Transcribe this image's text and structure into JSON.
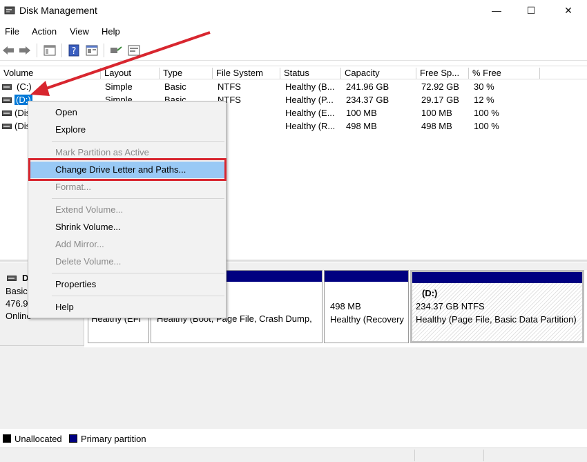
{
  "window": {
    "title": "Disk Management",
    "minimize": "—",
    "maximize": "☐",
    "close": "✕"
  },
  "menu": [
    "File",
    "Action",
    "View",
    "Help"
  ],
  "toolbar": {
    "icons": [
      "back-icon",
      "forward-icon",
      "console-tree-icon",
      "help-icon",
      "properties-icon",
      "connect-icon",
      "view-icon"
    ]
  },
  "volume_list": {
    "columns": [
      "Volume",
      "Layout",
      "Type",
      "File System",
      "Status",
      "Capacity",
      "Free Sp...",
      "% Free"
    ],
    "rows": [
      {
        "volume": "(C:)",
        "layout": "Simple",
        "type": "Basic",
        "fs": "NTFS",
        "status": "Healthy (B...",
        "capacity": "241.96 GB",
        "free": "72.92 GB",
        "pct": "30 %"
      },
      {
        "volume": "(D:)",
        "layout": "Simple",
        "type": "Basic",
        "fs": "NTFS",
        "status": "Healthy (P...",
        "capacity": "234.37 GB",
        "free": "29.17 GB",
        "pct": "12 %"
      },
      {
        "volume": "(Dis",
        "layout": "",
        "type": "",
        "fs": "",
        "status": "Healthy (E...",
        "capacity": "100 MB",
        "free": "100 MB",
        "pct": "100 %"
      },
      {
        "volume": "(Dis",
        "layout": "",
        "type": "",
        "fs": "",
        "status": "Healthy (R...",
        "capacity": "498 MB",
        "free": "498 MB",
        "pct": "100 %"
      }
    ]
  },
  "context_menu": {
    "items": [
      {
        "label": "Open",
        "enabled": true
      },
      {
        "label": "Explore",
        "enabled": true
      },
      {
        "label": "Mark Partition as Active",
        "enabled": false
      },
      {
        "label": "Change Drive Letter and Paths...",
        "enabled": true,
        "highlighted": true
      },
      {
        "label": "Format...",
        "enabled": false
      },
      {
        "label": "Extend Volume...",
        "enabled": false
      },
      {
        "label": "Shrink Volume...",
        "enabled": true
      },
      {
        "label": "Add Mirror...",
        "enabled": false
      },
      {
        "label": "Delete Volume...",
        "enabled": false
      },
      {
        "label": "Properties",
        "enabled": true
      },
      {
        "label": "Help",
        "enabled": true
      }
    ]
  },
  "disk": {
    "name": "D",
    "type": "Basic",
    "size": "476.9",
    "state": "Online",
    "partitions": [
      {
        "line1": "",
        "line2": "Healthy (EFI"
      },
      {
        "line1": "",
        "line2": "Healthy (Boot, Page File, Crash Dump,"
      },
      {
        "line1": "498 MB",
        "line2": "Healthy (Recovery"
      },
      {
        "title": "(D:)",
        "line1": "234.37 GB NTFS",
        "line2": "Healthy (Page File, Basic Data Partition)"
      }
    ]
  },
  "legend": [
    {
      "label": "Unallocated",
      "color": "#000000"
    },
    {
      "label": "Primary partition",
      "color": "#000080"
    }
  ],
  "colors": {
    "selection": "#0078d7",
    "highlight": "#99c9f5",
    "annotation": "#d8262f",
    "partition_bar": "#000080"
  }
}
